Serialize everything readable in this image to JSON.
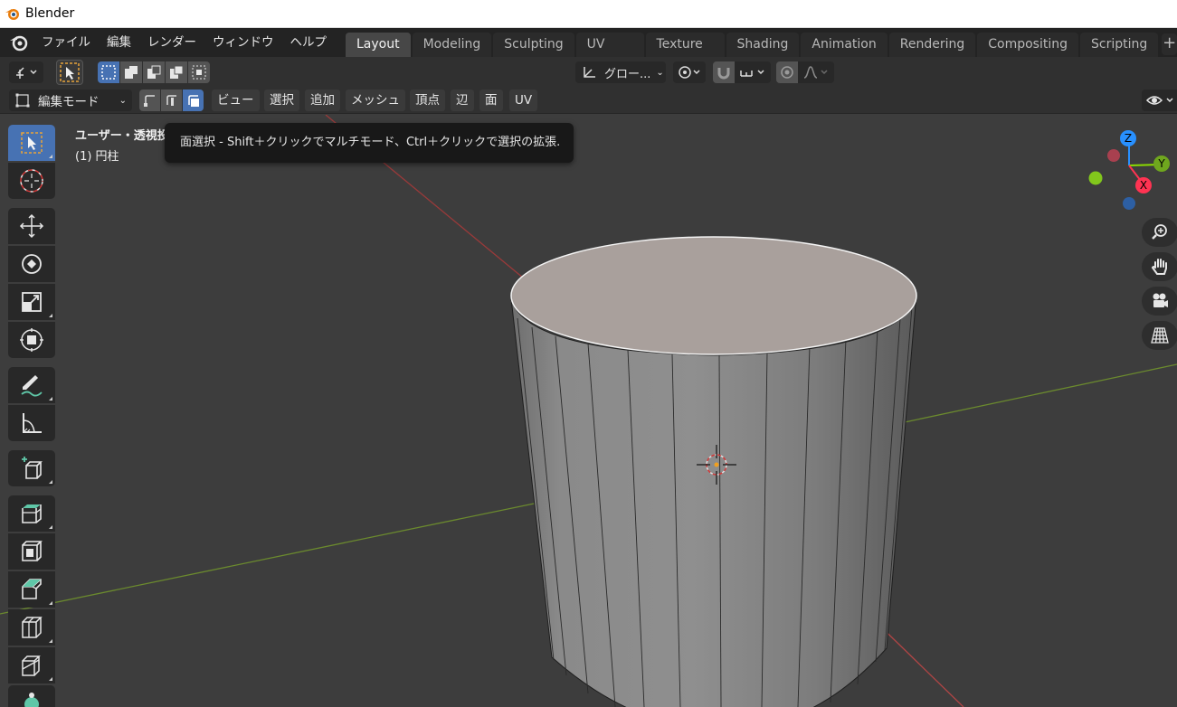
{
  "window": {
    "title": "Blender"
  },
  "menubar": {
    "items": [
      "ファイル",
      "編集",
      "レンダー",
      "ウィンドウ",
      "ヘルプ"
    ]
  },
  "workspaces": {
    "tabs": [
      "Layout",
      "Modeling",
      "Sculpting",
      "UV Editing",
      "Texture Paint",
      "Shading",
      "Animation",
      "Rendering",
      "Compositing",
      "Scripting"
    ],
    "active": "Layout",
    "add_label": "+"
  },
  "header": {
    "transform_orientation": "グロー...",
    "mode": "編集モード",
    "menus": [
      "ビュー",
      "選択",
      "追加",
      "メッシュ",
      "頂点",
      "辺",
      "面",
      "UV"
    ]
  },
  "viewport": {
    "info_line1": "ユーザー・透視投影",
    "info_line2": "(1) 円柱",
    "tooltip": "面選択 - Shift＋クリックでマルチモード、Ctrl＋クリックで選択の拡張.",
    "gizmo": {
      "z": "Z",
      "y": "Y",
      "x": "X"
    }
  },
  "colors": {
    "accent": "#4772b3",
    "x_axis": "#ff3352",
    "y_axis": "#8bdc00",
    "z_axis": "#2890ff"
  },
  "toolbar_tools": [
    "select-box",
    "cursor",
    "move",
    "rotate",
    "scale",
    "transform",
    "annotate",
    "measure",
    "add-cube",
    "extrude-region",
    "inset-faces",
    "bevel",
    "loop-cut",
    "knife",
    "poly-build"
  ]
}
